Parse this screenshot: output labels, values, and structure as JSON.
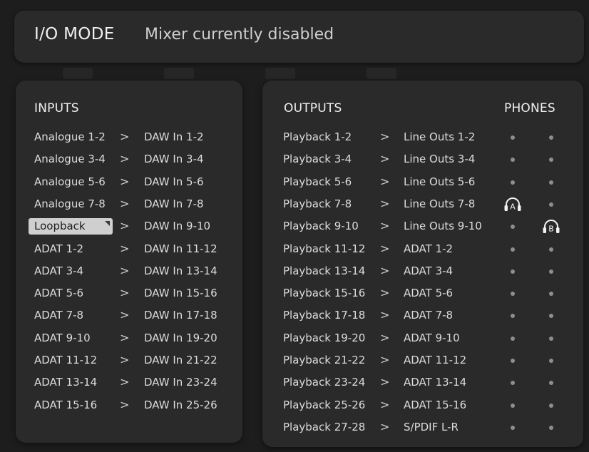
{
  "header": {
    "mode": "I/O MODE",
    "status": "Mixer currently disabled"
  },
  "inputs": {
    "title": "INPUTS",
    "arrow": ">",
    "rows": [
      {
        "source": "Analogue 1-2",
        "dest": "DAW In 1-2"
      },
      {
        "source": "Analogue 3-4",
        "dest": "DAW In 3-4"
      },
      {
        "source": "Analogue 5-6",
        "dest": "DAW In 5-6"
      },
      {
        "source": "Analogue 7-8",
        "dest": "DAW In 7-8"
      },
      {
        "source": "Loopback",
        "dest": "DAW In 9-10",
        "selected": true
      },
      {
        "source": "ADAT 1-2",
        "dest": "DAW In 11-12"
      },
      {
        "source": "ADAT 3-4",
        "dest": "DAW In 13-14"
      },
      {
        "source": "ADAT 5-6",
        "dest": "DAW In 15-16"
      },
      {
        "source": "ADAT 7-8",
        "dest": "DAW In 17-18"
      },
      {
        "source": "ADAT 9-10",
        "dest": "DAW In 19-20"
      },
      {
        "source": "ADAT 11-12",
        "dest": "DAW In 21-22"
      },
      {
        "source": "ADAT 13-14",
        "dest": "DAW In 23-24"
      },
      {
        "source": "ADAT 15-16",
        "dest": "DAW In 25-26"
      }
    ]
  },
  "outputs": {
    "title": "OUTPUTS",
    "phones_title": "PHONES",
    "arrow": ">",
    "phones_labels": {
      "a": "A",
      "b": "B"
    },
    "rows": [
      {
        "source": "Playback 1-2",
        "dest": "Line Outs 1-2",
        "phone_a": "dot",
        "phone_b": "dot"
      },
      {
        "source": "Playback 3-4",
        "dest": "Line Outs 3-4",
        "phone_a": "dot",
        "phone_b": "dot"
      },
      {
        "source": "Playback 5-6",
        "dest": "Line Outs 5-6",
        "phone_a": "dot",
        "phone_b": "dot"
      },
      {
        "source": "Playback 7-8",
        "dest": "Line Outs 7-8",
        "phone_a": "headphone-a",
        "phone_b": "dot"
      },
      {
        "source": "Playback 9-10",
        "dest": "Line Outs 9-10",
        "phone_a": "dot",
        "phone_b": "headphone-b"
      },
      {
        "source": "Playback 11-12",
        "dest": "ADAT 1-2",
        "phone_a": "dot",
        "phone_b": "dot"
      },
      {
        "source": "Playback 13-14",
        "dest": "ADAT 3-4",
        "phone_a": "dot",
        "phone_b": "dot"
      },
      {
        "source": "Playback 15-16",
        "dest": "ADAT 5-6",
        "phone_a": "dot",
        "phone_b": "dot"
      },
      {
        "source": "Playback 17-18",
        "dest": "ADAT 7-8",
        "phone_a": "dot",
        "phone_b": "dot"
      },
      {
        "source": "Playback 19-20",
        "dest": "ADAT 9-10",
        "phone_a": "dot",
        "phone_b": "dot"
      },
      {
        "source": "Playback 21-22",
        "dest": "ADAT 11-12",
        "phone_a": "dot",
        "phone_b": "dot"
      },
      {
        "source": "Playback 23-24",
        "dest": "ADAT 13-14",
        "phone_a": "dot",
        "phone_b": "dot"
      },
      {
        "source": "Playback 25-26",
        "dest": "ADAT 15-16",
        "phone_a": "dot",
        "phone_b": "dot"
      },
      {
        "source": "Playback 27-28",
        "dest": "S/PDIF L-R",
        "phone_a": "dot",
        "phone_b": "dot"
      }
    ]
  },
  "colors": {
    "background": "#1b1b1b",
    "panel": "#2a2a2a",
    "selected_chip": "#cfcfcf",
    "dot": "#8e8e8e"
  }
}
